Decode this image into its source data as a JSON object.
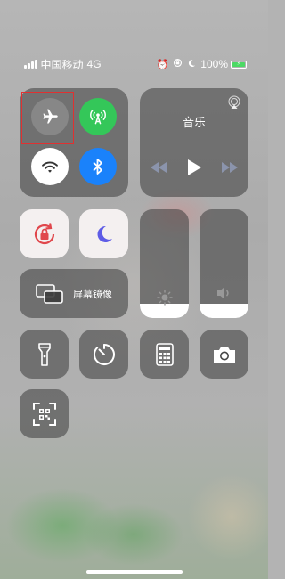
{
  "status_bar": {
    "carrier": "中国移动",
    "network": "4G",
    "battery_percent": "100%",
    "signal_bars": 4,
    "icons": [
      "alarm-icon",
      "orientation-lock-icon",
      "moon-icon",
      "battery-charging-icon"
    ]
  },
  "connectivity": {
    "airplane": {
      "icon": "airplane-icon",
      "on": false
    },
    "cellular": {
      "icon": "cellular-antenna-icon",
      "on": true,
      "color": "#34c759"
    },
    "wifi": {
      "icon": "wifi-icon",
      "on": true
    },
    "bluetooth": {
      "icon": "bluetooth-icon",
      "on": true,
      "color": "#1a82fb"
    }
  },
  "music": {
    "title": "音乐",
    "icons": [
      "airplay-icon",
      "previous-track-icon",
      "play-icon",
      "next-track-icon"
    ]
  },
  "orientation_lock": {
    "icon": "orientation-lock-icon",
    "on": true,
    "color": "#e0474c"
  },
  "do_not_disturb": {
    "icon": "moon-icon",
    "on": true,
    "color": "#5e5ce6"
  },
  "brightness": {
    "icon": "sun-icon",
    "level": 0.13
  },
  "volume": {
    "icon": "speaker-icon",
    "level": 0.13
  },
  "screen_mirroring": {
    "label": "屏幕镜像",
    "icon": "screen-mirroring-icon"
  },
  "utilities": [
    {
      "name": "flashlight",
      "icon": "flashlight-icon"
    },
    {
      "name": "timer",
      "icon": "timer-icon"
    },
    {
      "name": "calculator",
      "icon": "calculator-icon"
    },
    {
      "name": "camera",
      "icon": "camera-icon"
    }
  ],
  "qr_scanner": {
    "icon": "qr-code-scanner-icon"
  }
}
